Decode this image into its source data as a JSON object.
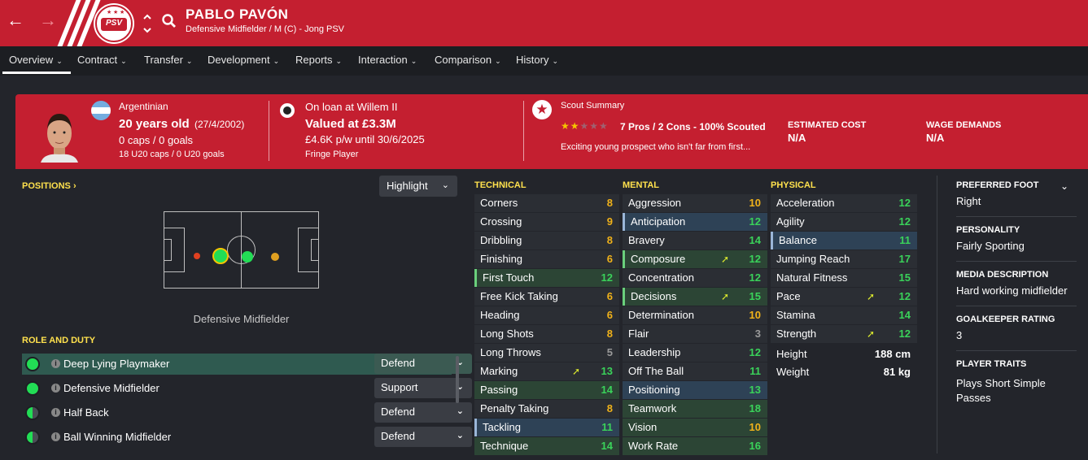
{
  "header": {
    "player_name": "PABLO PAVÓN",
    "subtitle": "Defensive Midfielder / M (C) - Jong PSV",
    "back_icon": "←",
    "forward_icon": "→",
    "club_badge": "PSV",
    "colors": {
      "accent": "#c41f30",
      "nav_bg": "#1c1e22"
    }
  },
  "tabs": [
    {
      "label": "Overview"
    },
    {
      "label": "Contract"
    },
    {
      "label": "Transfer"
    },
    {
      "label": "Development"
    },
    {
      "label": "Reports"
    },
    {
      "label": "Interaction"
    },
    {
      "label": "Comparison"
    },
    {
      "label": "History"
    }
  ],
  "info": {
    "nationality": "Argentinian",
    "age": "20 years old",
    "dob": "(27/4/2002)",
    "caps": "0 caps / 0 goals",
    "u20": "18 U20 caps / 0 U20 goals",
    "loan": "On loan at Willem II",
    "value": "Valued at £3.3M",
    "wage": "£4.6K p/w until 30/6/2025",
    "status": "Fringe Player",
    "scout_title": "Scout Summary",
    "scout_stars": 2,
    "scout_result": "7 Pros / 2 Cons - 100% Scouted",
    "scout_text": "Exciting young prospect who isn't far from first...",
    "cost_label": "ESTIMATED COST",
    "cost_value": "N/A",
    "wage_label": "WAGE DEMANDS",
    "wage_value": "N/A"
  },
  "positions": {
    "title": "POSITIONS",
    "highlight": "Highlight",
    "caption": "Defensive Midfielder"
  },
  "roles": {
    "title": "ROLE AND DUTY",
    "items": [
      {
        "name": "Deep Lying Playmaker",
        "duty": "Defend"
      },
      {
        "name": "Defensive Midfielder",
        "duty": "Support"
      },
      {
        "name": "Half Back",
        "duty": "Defend"
      },
      {
        "name": "Ball Winning Midfielder",
        "duty": "Defend"
      }
    ]
  },
  "technical": {
    "title": "TECHNICAL",
    "items": [
      {
        "name": "Corners",
        "value": "8"
      },
      {
        "name": "Crossing",
        "value": "9"
      },
      {
        "name": "Dribbling",
        "value": "8"
      },
      {
        "name": "Finishing",
        "value": "6"
      },
      {
        "name": "First Touch",
        "value": "12"
      },
      {
        "name": "Free Kick Taking",
        "value": "6"
      },
      {
        "name": "Heading",
        "value": "6"
      },
      {
        "name": "Long Shots",
        "value": "8"
      },
      {
        "name": "Long Throws",
        "value": "5"
      },
      {
        "name": "Marking",
        "value": "13"
      },
      {
        "name": "Passing",
        "value": "14"
      },
      {
        "name": "Penalty Taking",
        "value": "8"
      },
      {
        "name": "Tackling",
        "value": "11"
      },
      {
        "name": "Technique",
        "value": "14"
      }
    ]
  },
  "mental": {
    "title": "MENTAL",
    "items": [
      {
        "name": "Aggression",
        "value": "10"
      },
      {
        "name": "Anticipation",
        "value": "12"
      },
      {
        "name": "Bravery",
        "value": "14"
      },
      {
        "name": "Composure",
        "value": "12"
      },
      {
        "name": "Concentration",
        "value": "12"
      },
      {
        "name": "Decisions",
        "value": "15"
      },
      {
        "name": "Determination",
        "value": "10"
      },
      {
        "name": "Flair",
        "value": "3"
      },
      {
        "name": "Leadership",
        "value": "12"
      },
      {
        "name": "Off The Ball",
        "value": "11"
      },
      {
        "name": "Positioning",
        "value": "13"
      },
      {
        "name": "Teamwork",
        "value": "18"
      },
      {
        "name": "Vision",
        "value": "10"
      },
      {
        "name": "Work Rate",
        "value": "16"
      }
    ]
  },
  "physical": {
    "title": "PHYSICAL",
    "items": [
      {
        "name": "Acceleration",
        "value": "12"
      },
      {
        "name": "Agility",
        "value": "12"
      },
      {
        "name": "Balance",
        "value": "11"
      },
      {
        "name": "Jumping Reach",
        "value": "17"
      },
      {
        "name": "Natural Fitness",
        "value": "15"
      },
      {
        "name": "Pace",
        "value": "12"
      },
      {
        "name": "Stamina",
        "value": "14"
      },
      {
        "name": "Strength",
        "value": "12"
      }
    ],
    "height_label": "Height",
    "height": "188 cm",
    "weight_label": "Weight",
    "weight": "81 kg"
  },
  "side": {
    "foot_label": "PREFERRED FOOT",
    "foot": "Right",
    "personality_label": "PERSONALITY",
    "personality": "Fairly Sporting",
    "media_label": "MEDIA DESCRIPTION",
    "media": "Hard working midfielder",
    "gk_label": "GOALKEEPER RATING",
    "gk": "3",
    "traits_label": "PLAYER TRAITS",
    "traits": "Plays Short Simple Passes"
  }
}
